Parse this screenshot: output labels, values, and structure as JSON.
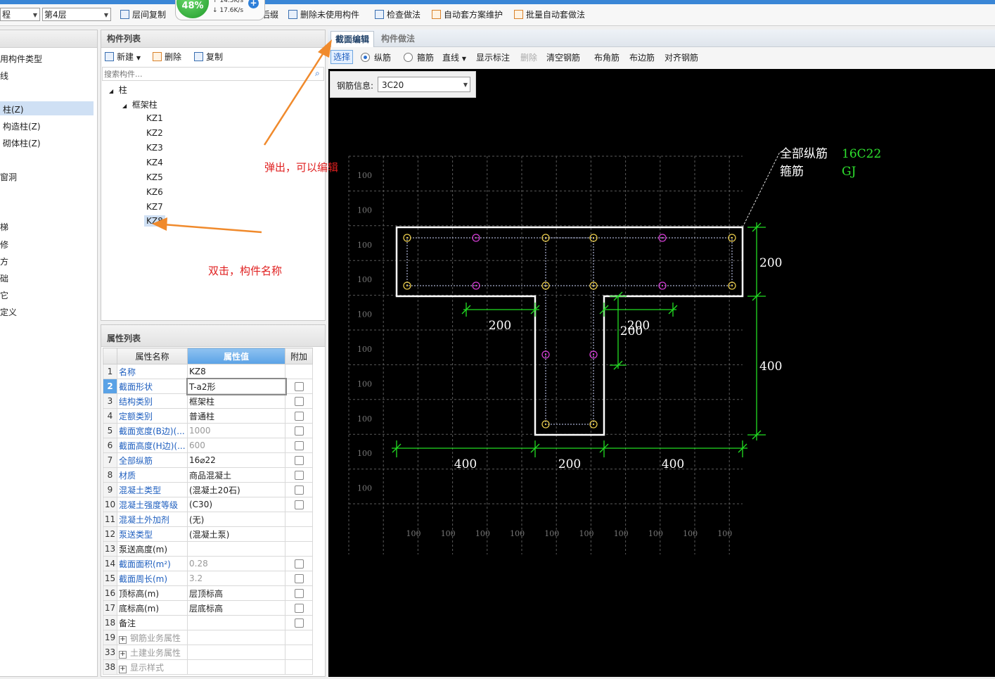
{
  "toolbar": {
    "project_combo": "程",
    "floor_combo": "第4层",
    "floor_copy": "层间复制",
    "hidden_after": "后缀",
    "delete_unused": "删除未使用构件",
    "check_method": "检查做法",
    "auto_maintain": "自动套方案维护",
    "batch_auto": "批量自动套做法"
  },
  "speed_widget": {
    "percent": "48%",
    "up": "↑ 14.5K/s",
    "down": "↓ 17.6K/s"
  },
  "left_nav": {
    "items": [
      "用构件类型",
      "线",
      "柱(Z)",
      "构造柱(Z)",
      "砌体柱(Z)",
      "窗洞",
      "梯",
      "修",
      "方",
      "础",
      "它",
      "定义"
    ]
  },
  "component_list": {
    "title": "构件列表",
    "new_label": "新建",
    "delete_label": "删除",
    "copy_label": "复制",
    "search_placeholder": "搜索构件...",
    "tree_root": "柱",
    "tree_group": "框架柱",
    "items": [
      "KZ1",
      "KZ2",
      "KZ3",
      "KZ4",
      "KZ5",
      "KZ6",
      "KZ7",
      "KZ8"
    ]
  },
  "property_list": {
    "title": "属性列表",
    "headers": {
      "name": "属性名称",
      "value": "属性值",
      "extra": "附加"
    },
    "rows": [
      {
        "n": "1",
        "name": "名称",
        "value": "KZ8",
        "link": true,
        "check": false,
        "gray": false
      },
      {
        "n": "2",
        "name": "截面形状",
        "value": "T-a2形",
        "link": true,
        "check": true,
        "gray": false
      },
      {
        "n": "3",
        "name": "结构类别",
        "value": "框架柱",
        "link": true,
        "check": true,
        "gray": false
      },
      {
        "n": "4",
        "name": "定额类别",
        "value": "普通柱",
        "link": true,
        "check": true,
        "gray": false
      },
      {
        "n": "5",
        "name": "截面宽度(B边)(...",
        "value": "1000",
        "link": true,
        "check": true,
        "gray": true
      },
      {
        "n": "6",
        "name": "截面高度(H边)(...",
        "value": "600",
        "link": true,
        "check": true,
        "gray": true
      },
      {
        "n": "7",
        "name": "全部纵筋",
        "value": "16⌀22",
        "link": true,
        "check": true,
        "gray": false
      },
      {
        "n": "8",
        "name": "材质",
        "value": "商品混凝土",
        "link": true,
        "check": true,
        "gray": false
      },
      {
        "n": "9",
        "name": "混凝土类型",
        "value": "(混凝土20石)",
        "link": true,
        "check": true,
        "gray": false
      },
      {
        "n": "10",
        "name": "混凝土强度等级",
        "value": "(C30)",
        "link": true,
        "check": true,
        "gray": false
      },
      {
        "n": "11",
        "name": "混凝土外加剂",
        "value": "(无)",
        "link": true,
        "check": false,
        "gray": false
      },
      {
        "n": "12",
        "name": "泵送类型",
        "value": "(混凝土泵)",
        "link": true,
        "check": false,
        "gray": false
      },
      {
        "n": "13",
        "name": "泵送高度(m)",
        "value": "",
        "link": false,
        "check": false,
        "gray": false
      },
      {
        "n": "14",
        "name": "截面面积(m²)",
        "value": "0.28",
        "link": true,
        "check": true,
        "gray": true
      },
      {
        "n": "15",
        "name": "截面周长(m)",
        "value": "3.2",
        "link": true,
        "check": true,
        "gray": true
      },
      {
        "n": "16",
        "name": "顶标高(m)",
        "value": "层顶标高",
        "link": false,
        "check": true,
        "gray": false
      },
      {
        "n": "17",
        "name": "底标高(m)",
        "value": "层底标高",
        "link": false,
        "check": true,
        "gray": false
      },
      {
        "n": "18",
        "name": "备注",
        "value": "",
        "link": false,
        "check": true,
        "gray": false
      },
      {
        "n": "19",
        "name": "钢筋业务属性",
        "value": "",
        "link": false,
        "check": false,
        "gray": true,
        "expand": true
      },
      {
        "n": "33",
        "name": "土建业务属性",
        "value": "",
        "link": false,
        "check": false,
        "gray": true,
        "expand": true
      },
      {
        "n": "38",
        "name": "显示样式",
        "value": "",
        "link": false,
        "check": false,
        "gray": true,
        "expand": true
      }
    ]
  },
  "editor": {
    "tab_section": "截面编辑",
    "tab_method": "构件做法",
    "tools": {
      "select": "选择",
      "longitudinal": "纵筋",
      "stirrup": "箍筋",
      "line": "直线",
      "show_annot": "显示标注",
      "delete": "删除",
      "clear": "清空钢筋",
      "corner": "布角筋",
      "edge": "布边筋",
      "align": "对齐钢筋"
    },
    "rebar_info_label": "钢筋信息:",
    "rebar_info_value": "3C20"
  },
  "drawing": {
    "grid_label": "100",
    "legend_line1_label": "全部纵筋",
    "legend_line1_value": "16C22",
    "legend_line2_label": "箍筋",
    "legend_line2_value": "GJ",
    "dims": {
      "right_top": "200",
      "right_bottom": "400",
      "inner_left": "200",
      "inner_right": "200",
      "inner_right_v": "200",
      "bottom_left": "400",
      "bottom_mid": "200",
      "bottom_right": "400"
    },
    "colors": {
      "outline": "#ffffff",
      "dim": "#22dd22",
      "corner_bar": "#e6c84a",
      "edge_bar": "#d23cd2",
      "grid": "#5a5a5a"
    }
  },
  "annotations": {
    "popup_note": "弹出，可以编辑",
    "dblclick_note": "双击，构件名称"
  }
}
